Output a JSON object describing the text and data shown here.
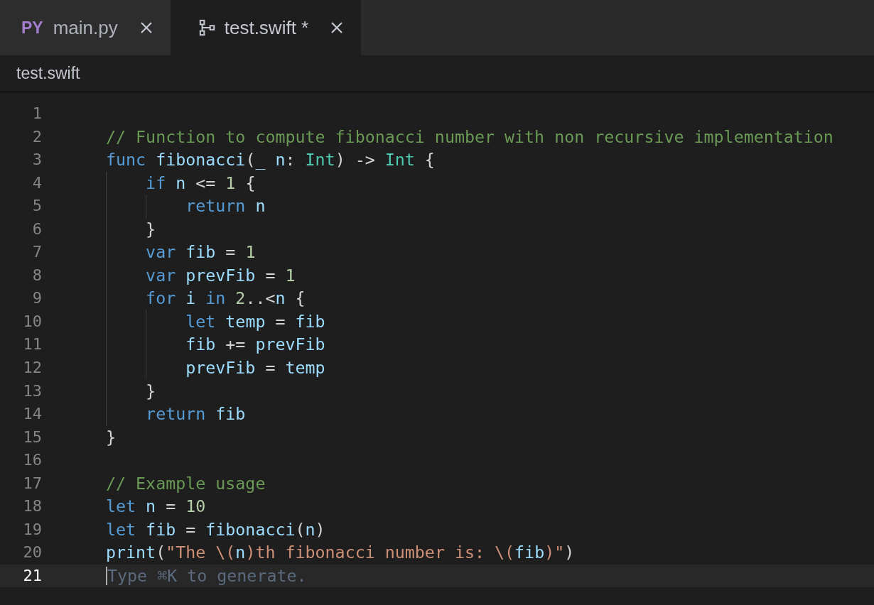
{
  "tabs": [
    {
      "kind": "python",
      "badge": "PY",
      "label": "main.py",
      "selected": false
    },
    {
      "kind": "swift",
      "label": "test.swift *",
      "selected": true
    }
  ],
  "breadcrumb": "test.swift",
  "lines": [
    {
      "number": "1",
      "current": false
    },
    {
      "number": "2",
      "current": false,
      "tokens": [
        {
          "kind": "comment",
          "text": "// Function to compute fibonacci number with non recursive implementation"
        }
      ]
    },
    {
      "number": "3",
      "current": false,
      "tokens": [
        {
          "kind": "keyword",
          "text": "func "
        },
        {
          "kind": "name",
          "text": "fibonacci"
        },
        {
          "kind": "plain",
          "text": "("
        },
        {
          "kind": "name",
          "text": "_ n"
        },
        {
          "kind": "plain",
          "text": ": "
        },
        {
          "kind": "type",
          "text": "Int"
        },
        {
          "kind": "plain",
          "text": ") -> "
        },
        {
          "kind": "type",
          "text": "Int"
        },
        {
          "kind": "plain",
          "text": " {"
        }
      ]
    },
    {
      "number": "4",
      "current": false,
      "tokens": [
        {
          "kind": "keyword",
          "text": "    if "
        },
        {
          "kind": "name",
          "text": "n"
        },
        {
          "kind": "plain",
          "text": " <= "
        },
        {
          "kind": "number",
          "text": "1"
        },
        {
          "kind": "plain",
          "text": " {"
        }
      ]
    },
    {
      "number": "5",
      "current": false,
      "tokens": [
        {
          "kind": "keyword",
          "text": "        return "
        },
        {
          "kind": "name",
          "text": "n"
        }
      ]
    },
    {
      "number": "6",
      "current": false,
      "tokens": [
        {
          "kind": "plain",
          "text": "    }"
        }
      ]
    },
    {
      "number": "7",
      "current": false,
      "tokens": [
        {
          "kind": "keyword",
          "text": "    var "
        },
        {
          "kind": "name",
          "text": "fib"
        },
        {
          "kind": "plain",
          "text": " = "
        },
        {
          "kind": "number",
          "text": "1"
        }
      ]
    },
    {
      "number": "8",
      "current": false,
      "tokens": [
        {
          "kind": "keyword",
          "text": "    var "
        },
        {
          "kind": "name",
          "text": "prevFib"
        },
        {
          "kind": "plain",
          "text": " = "
        },
        {
          "kind": "number",
          "text": "1"
        }
      ]
    },
    {
      "number": "9",
      "current": false,
      "tokens": [
        {
          "kind": "keyword",
          "text": "    for "
        },
        {
          "kind": "name",
          "text": "i "
        },
        {
          "kind": "keyword",
          "text": "in "
        },
        {
          "kind": "number",
          "text": "2"
        },
        {
          "kind": "plain",
          "text": "..<"
        },
        {
          "kind": "name",
          "text": "n"
        },
        {
          "kind": "plain",
          "text": " {"
        }
      ]
    },
    {
      "number": "10",
      "current": false,
      "tokens": [
        {
          "kind": "keyword",
          "text": "        let "
        },
        {
          "kind": "name",
          "text": "temp"
        },
        {
          "kind": "plain",
          "text": " = "
        },
        {
          "kind": "name",
          "text": "fib"
        }
      ]
    },
    {
      "number": "11",
      "current": false,
      "tokens": [
        {
          "kind": "name",
          "text": "        fib"
        },
        {
          "kind": "plain",
          "text": " += "
        },
        {
          "kind": "name",
          "text": "prevFib"
        }
      ]
    },
    {
      "number": "12",
      "current": false,
      "tokens": [
        {
          "kind": "name",
          "text": "        prevFib"
        },
        {
          "kind": "plain",
          "text": " = "
        },
        {
          "kind": "name",
          "text": "temp"
        }
      ]
    },
    {
      "number": "13",
      "current": false,
      "tokens": [
        {
          "kind": "plain",
          "text": "    }"
        }
      ]
    },
    {
      "number": "14",
      "current": false,
      "tokens": [
        {
          "kind": "keyword",
          "text": "    return "
        },
        {
          "kind": "name",
          "text": "fib"
        }
      ]
    },
    {
      "number": "15",
      "current": false,
      "tokens": [
        {
          "kind": "plain",
          "text": "}"
        }
      ]
    },
    {
      "number": "16",
      "current": false
    },
    {
      "number": "17",
      "current": false,
      "tokens": [
        {
          "kind": "comment",
          "text": "// Example usage"
        }
      ]
    },
    {
      "number": "18",
      "current": false,
      "tokens": [
        {
          "kind": "keyword",
          "text": "let "
        },
        {
          "kind": "name",
          "text": "n"
        },
        {
          "kind": "plain",
          "text": " = "
        },
        {
          "kind": "number",
          "text": "10"
        }
      ]
    },
    {
      "number": "19",
      "current": false,
      "tokens": [
        {
          "kind": "keyword",
          "text": "let "
        },
        {
          "kind": "name",
          "text": "fib"
        },
        {
          "kind": "plain",
          "text": " = "
        },
        {
          "kind": "name",
          "text": "fibonacci"
        },
        {
          "kind": "plain",
          "text": "("
        },
        {
          "kind": "name",
          "text": "n"
        },
        {
          "kind": "plain",
          "text": ")"
        }
      ]
    },
    {
      "number": "20",
      "current": false,
      "tokens": [
        {
          "kind": "name",
          "text": "print"
        },
        {
          "kind": "plain",
          "text": "("
        },
        {
          "kind": "string",
          "text": "\"The \\("
        },
        {
          "kind": "name",
          "text": "n"
        },
        {
          "kind": "string",
          "text": ")th fibonacci number is: \\("
        },
        {
          "kind": "name",
          "text": "fib"
        },
        {
          "kind": "string",
          "text": ")\""
        },
        {
          "kind": "plain",
          "text": ")"
        }
      ]
    },
    {
      "number": "21",
      "current": true,
      "placeholder": "Type ⌘K to generate."
    }
  ]
}
